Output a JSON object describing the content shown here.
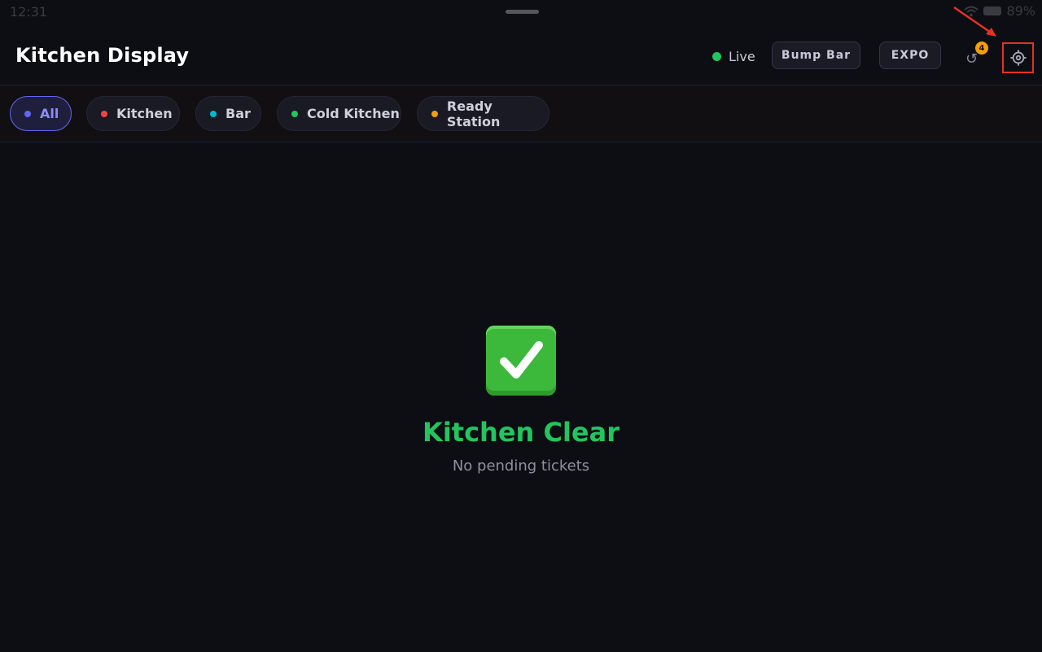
{
  "status_bar": {
    "time": "12:31",
    "battery": "89%"
  },
  "header": {
    "title": "Kitchen Display",
    "live_label": "Live",
    "bump_bar_label": "Bump Bar",
    "expo_label": "EXPO",
    "refresh_badge": "4",
    "live_color": "#22c55e",
    "badge_color": "#f59e0b"
  },
  "filters": [
    {
      "label": "All",
      "color": "#6366f1",
      "active": true
    },
    {
      "label": "Kitchen",
      "color": "#ef4444",
      "active": false
    },
    {
      "label": "Bar",
      "color": "#06b6d4",
      "active": false
    },
    {
      "label": "Cold Kitchen",
      "color": "#22c55e",
      "active": false
    },
    {
      "label": "Ready Station",
      "color": "#f59e0b",
      "active": false
    }
  ],
  "empty_state": {
    "icon": "check-mark-icon",
    "title": "Kitchen Clear",
    "subtitle": "No pending tickets"
  }
}
